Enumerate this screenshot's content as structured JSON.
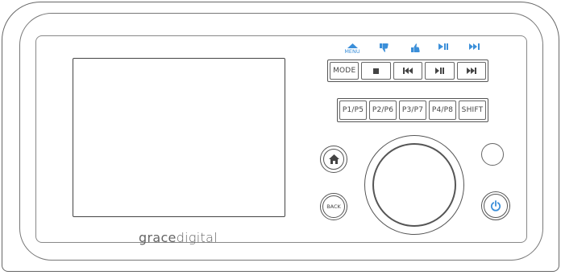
{
  "brand": {
    "part1": "grace",
    "part2": "digital"
  },
  "top_icons": [
    {
      "icon": "menu-up-arrow-icon",
      "label": "MENU"
    },
    {
      "icon": "thumbs-down-icon",
      "label": ""
    },
    {
      "icon": "thumbs-up-icon",
      "label": ""
    },
    {
      "icon": "play-pause-icon",
      "label": ""
    },
    {
      "icon": "skip-forward-icon",
      "label": ""
    }
  ],
  "row1_buttons": [
    {
      "label": "MODE",
      "icon": ""
    },
    {
      "label": "",
      "icon": "stop-icon"
    },
    {
      "label": "",
      "icon": "skip-back-icon"
    },
    {
      "label": "",
      "icon": "play-pause-icon"
    },
    {
      "label": "",
      "icon": "skip-forward-icon"
    }
  ],
  "row2_buttons": [
    {
      "label": "P1/P5"
    },
    {
      "label": "P2/P6"
    },
    {
      "label": "P3/P7"
    },
    {
      "label": "P4/P8"
    },
    {
      "label": "SHIFT"
    }
  ],
  "back_label": "BACK",
  "colors": {
    "accent": "#3b8fd9",
    "outline": "#555555"
  }
}
